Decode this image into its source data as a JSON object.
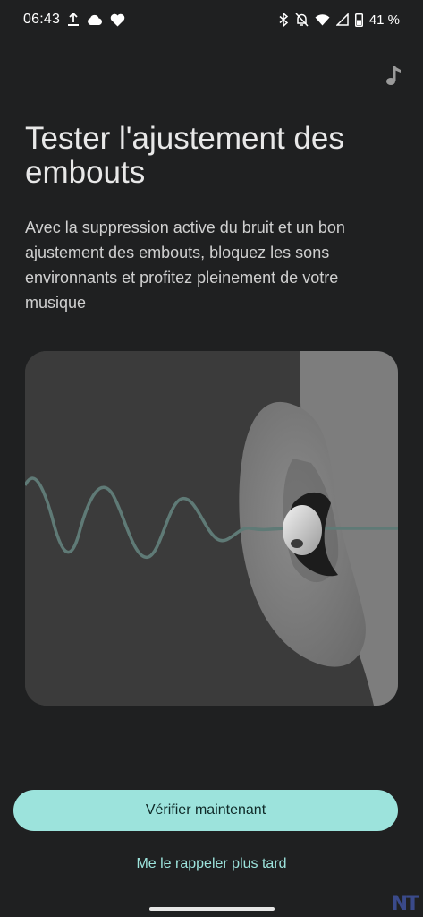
{
  "status_bar": {
    "time": "06:43",
    "battery": "41 %",
    "left_icons": [
      "upload-icon",
      "cloud-icon",
      "heart-icon"
    ],
    "right_icons": [
      "bluetooth-icon",
      "notifications-off-icon",
      "wifi-icon",
      "cellular-icon",
      "battery-icon"
    ]
  },
  "header": {
    "music_icon": "music-note-icon"
  },
  "main": {
    "title": "Tester l'ajustement des embouts",
    "description": "Avec la suppression active du bruit et un bon ajustement des embouts, bloquez les sons environnants et profitez pleinement de votre musique"
  },
  "actions": {
    "primary_label": "Vérifier maintenant",
    "secondary_label": "Me le rappeler plus tard"
  },
  "watermark": "NT",
  "colors": {
    "background": "#1f2021",
    "accent": "#9ce3dc",
    "wave": "#5f7a76"
  }
}
